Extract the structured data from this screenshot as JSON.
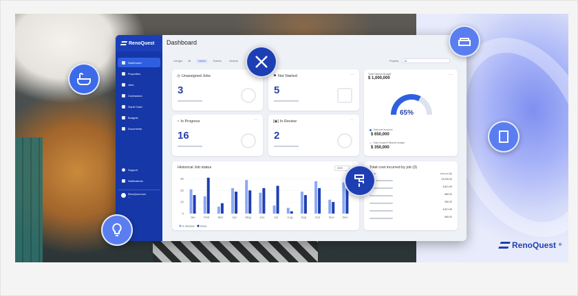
{
  "brand": {
    "name": "RenoQuest",
    "registered": "®"
  },
  "sidebar": {
    "logo": "RenoQuest",
    "items": [
      {
        "label": "Dashboard",
        "icon": "dashboard-icon",
        "active": true
      },
      {
        "label": "Properties",
        "icon": "building-icon"
      },
      {
        "label": "Jobs",
        "icon": "tools-icon"
      },
      {
        "label": "Contractors",
        "icon": "person-icon"
      },
      {
        "label": "Gantt Chart",
        "icon": "gantt-icon"
      },
      {
        "label": "Budgets",
        "icon": "document-icon"
      },
      {
        "label": "Documents",
        "icon": "folder-icon"
      }
    ],
    "bottom_items": [
      {
        "label": "Support",
        "icon": "support-icon"
      },
      {
        "label": "Notifications",
        "icon": "bell-icon"
      }
    ],
    "user": {
      "name": "RenoQuest User",
      "sub": "—"
    }
  },
  "page": {
    "title": "Dashboard",
    "filters": {
      "label": "Job type",
      "options": [
        "All",
        "Interior",
        "Exterior",
        "General"
      ],
      "selected": "Interior"
    },
    "property": {
      "label": "Property",
      "value": "All"
    }
  },
  "stats": [
    {
      "title": "Unassigned Jobs",
      "value": "3"
    },
    {
      "title": "Not Started",
      "value": "5"
    },
    {
      "title": "In Progress",
      "value": "16"
    },
    {
      "title": "In Review",
      "value": "2"
    }
  ],
  "budget": {
    "planned_label": "Total Planned Budget",
    "planned_value": "$ 1,000,000",
    "percent": "65%",
    "percent_fraction": 0.65,
    "incurred_label": "Total cost incurred",
    "incurred_value": "$ 650,000",
    "unused_label": "Total Unused Planned budget",
    "unused_value": "$ 350,000",
    "colors": {
      "used": "#2f5fe0",
      "remaining": "#dde2ee"
    }
  },
  "historical": {
    "title": "Historical Job status",
    "year": "2023"
  },
  "chart_data": {
    "type": "bar",
    "title": "Historical Job status",
    "categories": [
      "Jan",
      "Feb",
      "Mar",
      "Apr",
      "May",
      "Jun",
      "Jul",
      "Aug",
      "Sep",
      "Oct",
      "Nov",
      "Dec"
    ],
    "series": [
      {
        "name": "In Review",
        "color": "#8aa8f3",
        "values": [
          21,
          15,
          6,
          22,
          29,
          18,
          7,
          5,
          19,
          28,
          12,
          27
        ]
      },
      {
        "name": "Done",
        "color": "#1e3fb3",
        "values": [
          16,
          31,
          9,
          19,
          20,
          22,
          24,
          2,
          16,
          22,
          10,
          31
        ]
      }
    ],
    "ylim": [
      0,
      32
    ],
    "yticks": [
      0,
      10,
      20,
      30
    ],
    "legend": "bottom-left"
  },
  "costs": {
    "title": "Total cost incurred by job (3)",
    "col_name": "Name",
    "col_amount": "Amount ($)",
    "amounts": [
      "23,026.00",
      "3,821.99",
      "865.92",
      "360.00",
      "3,821.99",
      "865.92"
    ]
  },
  "bubbles": [
    "bath-icon",
    "tools-icon",
    "sofa-icon",
    "wallpaper-icon",
    "paint-roller-icon",
    "lightbulb-icon"
  ]
}
